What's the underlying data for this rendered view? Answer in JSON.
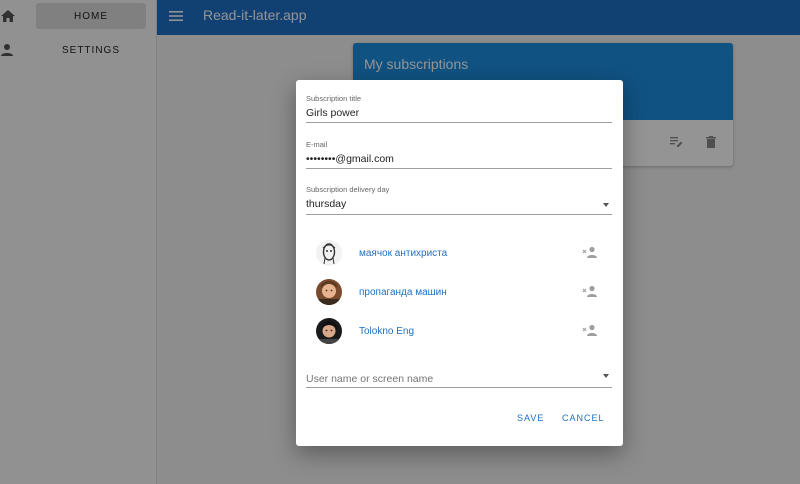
{
  "sidebar": {
    "items": [
      {
        "label": "HOME",
        "icon": "home-icon",
        "active": true
      },
      {
        "label": "SETTINGS",
        "icon": "person-icon",
        "active": false
      }
    ]
  },
  "appbar": {
    "title": "Read-it-later.app",
    "menu_icon": "menu-icon"
  },
  "card": {
    "title": "My subscriptions",
    "actions": [
      {
        "icon": "edit-list-icon"
      },
      {
        "icon": "delete-icon"
      }
    ]
  },
  "dialog": {
    "subscription_title": {
      "label": "Subscription title",
      "value": "Girls power"
    },
    "email": {
      "label": "E-mail",
      "value": "••••••••@gmail.com"
    },
    "delivery_day": {
      "label": "Subscription delivery day",
      "value": "thursday"
    },
    "subscriptions": [
      {
        "name": "маячок антихриста"
      },
      {
        "name": "пропаганда машин"
      },
      {
        "name": "Tolokno Eng"
      }
    ],
    "user_search": {
      "placeholder": "User name or screen name"
    },
    "save_label": "SAVE",
    "cancel_label": "CANCEL"
  },
  "colors": {
    "primary": "#1e6fc4",
    "card_header": "#1d8ee0",
    "overlay": "rgba(0,0,0,0.42)"
  }
}
